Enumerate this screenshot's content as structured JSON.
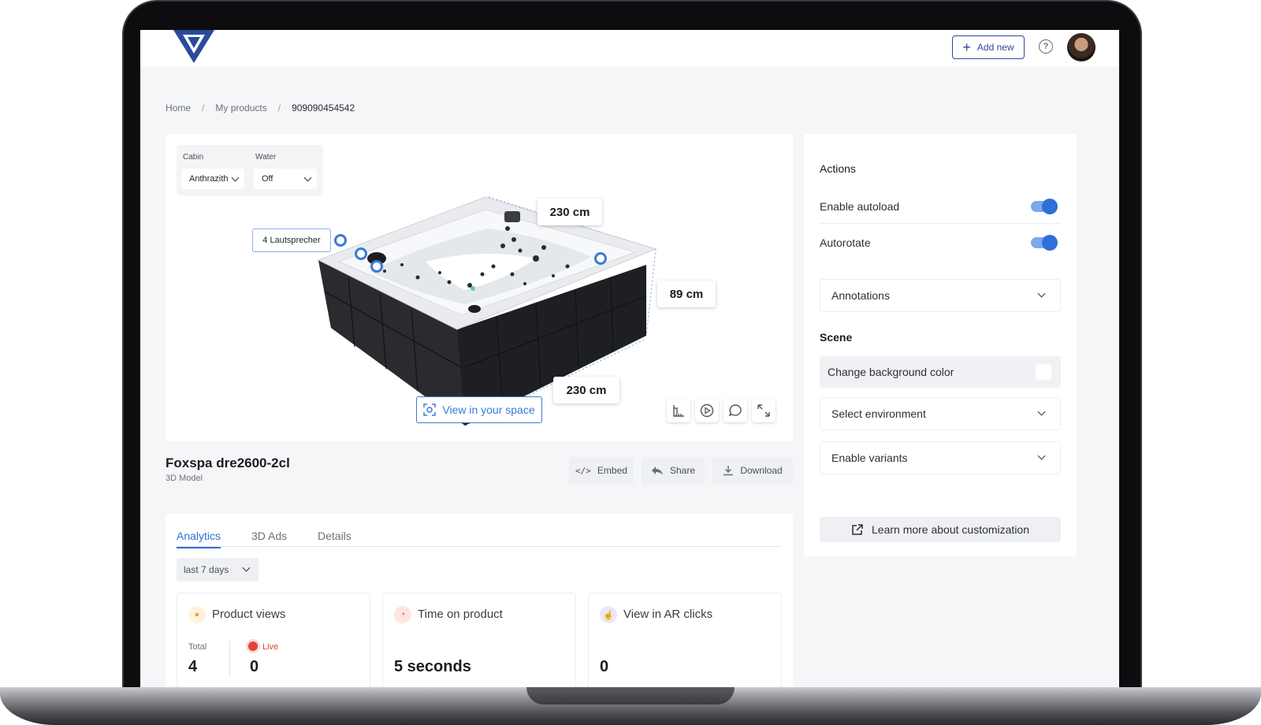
{
  "header": {
    "add_new_label": "Add new",
    "help_symbol": "?"
  },
  "breadcrumb": {
    "home": "Home",
    "separator": "/",
    "products": "My products",
    "current": "909090454542"
  },
  "viewer": {
    "variants": {
      "cabin_label": "Cabin",
      "cabin_value": "Anthrazith",
      "water_label": "Water",
      "water_value": "Off"
    },
    "dimensions": {
      "top": "230 cm",
      "height": "89 cm",
      "bottom": "230 cm"
    },
    "annotation_label": "4 Lautsprecher",
    "ar_button": "View in your space",
    "tools": [
      "measure-icon",
      "play-icon",
      "comment-icon",
      "expand-icon"
    ]
  },
  "product": {
    "title": "Foxspa dre2600-2cl",
    "subtitle": "3D Model",
    "embed_label": "Embed",
    "share_label": "Share",
    "download_label": "Download"
  },
  "analytics": {
    "tabs": [
      "Analytics",
      "3D Ads",
      "Details"
    ],
    "active_tab": "Analytics",
    "period": "last 7 days",
    "cards": {
      "views": {
        "title": "Product views",
        "total_label": "Total",
        "total_value": "4",
        "live_label": "Live",
        "live_value": "0"
      },
      "time": {
        "title": "Time on product",
        "value": "5 seconds"
      },
      "ar": {
        "title": "View in AR clicks",
        "value": "0"
      }
    }
  },
  "panel": {
    "actions_heading": "Actions",
    "autoload_label": "Enable autoload",
    "autoload_on": true,
    "autorotate_label": "Autorotate",
    "autorotate_on": true,
    "annotations_label": "Annotations",
    "scene_heading": "Scene",
    "background_label": "Change background color",
    "environment_label": "Select environment",
    "variants_label": "Enable variants",
    "learn_more_label": "Learn more about customization"
  },
  "colors": {
    "accent": "#2f6fd6",
    "brand": "#2b4a9b",
    "live": "#e0453a"
  }
}
